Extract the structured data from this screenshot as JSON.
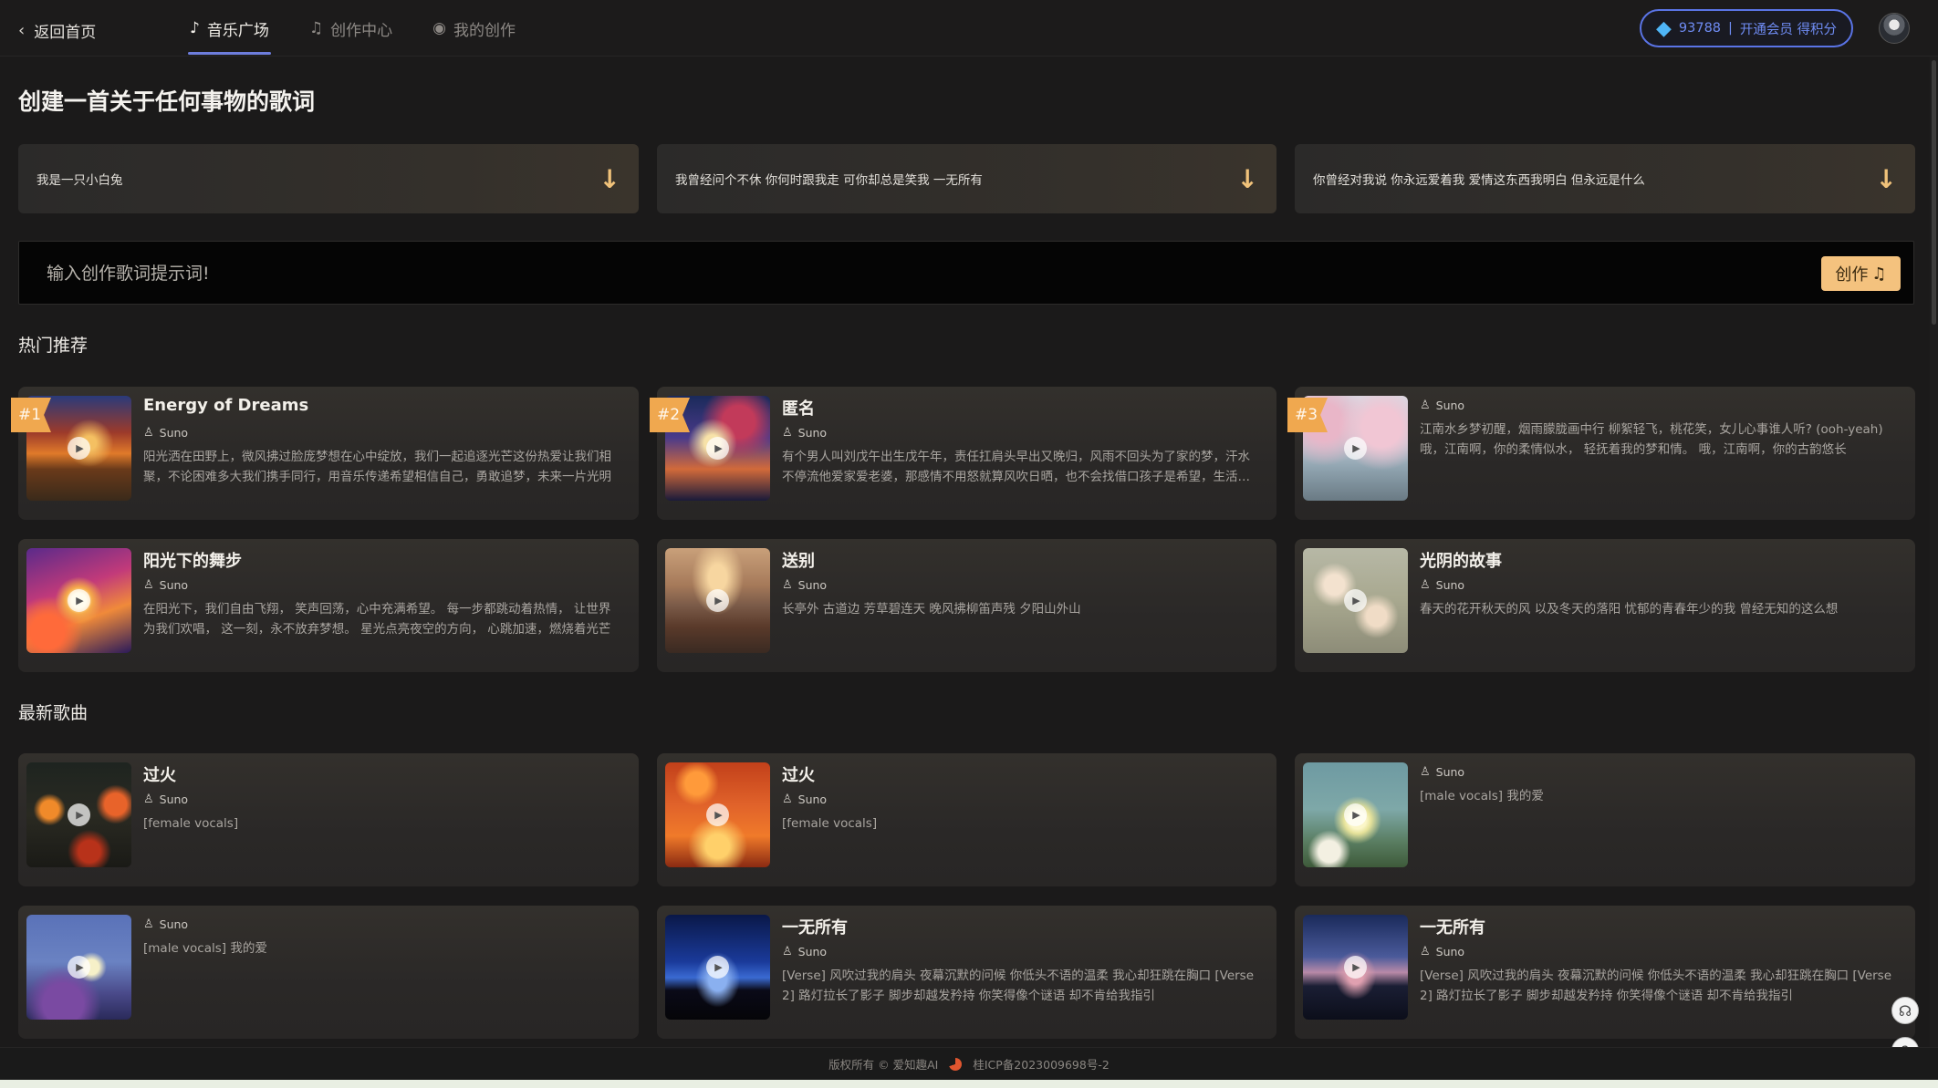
{
  "header": {
    "back_label": "返回首页",
    "tabs": [
      {
        "label": "音乐广场",
        "icon": "music-plaza-icon",
        "active": true
      },
      {
        "label": "创作中心",
        "icon": "music-note-icon",
        "active": false
      },
      {
        "label": "我的创作",
        "icon": "lightbulb-icon",
        "active": false
      }
    ],
    "member_points": "93788",
    "member_sep": "|",
    "member_label": "开通会员 得积分"
  },
  "page_title": "创建一首关于任何事物的歌词",
  "suggestions": [
    {
      "text": "我是一只小白兔",
      "icon": "arrow-down-icon"
    },
    {
      "text": "我曾经问个不休 你何时跟我走 可你却总是笑我 一无所有",
      "icon": "arrow-down-icon"
    },
    {
      "text": "你曾经对我说 你永远爱着我 爱情这东西我明白 但永远是什么",
      "icon": "arrow-down-icon"
    }
  ],
  "prompt": {
    "placeholder": "输入创作歌词提示词!",
    "button_label": "创作"
  },
  "sections": {
    "hot": "热门推荐",
    "latest": "最新歌曲"
  },
  "hot_songs": [
    {
      "rank": "#1",
      "title": "Energy of Dreams",
      "author": "Suno",
      "lyrics": "阳光洒在田野上，微风拂过脸庞梦想在心中绽放，我们一起追逐光芒这份热爱让我们相聚，不论困难多大我们携手同行，用音乐传递希望相信自己，勇敢追梦，未来一片光明",
      "cover": "sunset-tree"
    },
    {
      "rank": "#2",
      "title": "匿名",
      "author": "Suno",
      "lyrics": "有个男人叫刘戊午出生戊午年，责任扛肩头早出又晚归，风雨不回头为了家的梦，汗水不停流他爱家爱老婆，那感情不用怒就算风吹日晒，也不会找借口孩子是希望，生活的力量",
      "cover": "storm-clouds"
    },
    {
      "rank": "#3",
      "title": "",
      "author": "Suno",
      "lyrics": "江南水乡梦初醒，烟雨朦胧画中行 柳絮轻飞，桃花笑，女儿心事谁人听? (ooh-yeah) 哦，江南啊，你的柔情似水， 轻抚着我的梦和情。 哦，江南啊，你的古韵悠长",
      "cover": "blossom-lake"
    },
    {
      "rank": "",
      "title": "阳光下的舞步",
      "author": "Suno",
      "lyrics": "在阳光下，我们自由飞翔， 笑声回荡，心中充满希望。 每一步都跳动着热情， 让世界为我们欢唱， 这一刻，永不放弃梦想。 星光点亮夜空的方向， 心跳加速，燃烧着光芒",
      "cover": "colorful-sun"
    },
    {
      "rank": "",
      "title": "送别",
      "author": "Suno",
      "lyrics": "长亭外 古道边 芳草碧连天 晚风拂柳笛声残 夕阳山外山",
      "cover": "river-dusk"
    },
    {
      "rank": "",
      "title": "光阴的故事",
      "author": "Suno",
      "lyrics": "春天的花开秋天的风 以及冬天的落阳 忧郁的青春年少的我 曾经无知的这么想",
      "cover": "pale-flowers"
    }
  ],
  "latest_songs": [
    {
      "title": "过火",
      "author": "Suno",
      "lyrics": "[female vocals]",
      "cover": "lanterns-dark"
    },
    {
      "title": "过火",
      "author": "Suno",
      "lyrics": "[female vocals]",
      "cover": "lanterns-orange"
    },
    {
      "title": "",
      "author": "Suno",
      "lyrics": "[male vocals] 我的爱",
      "cover": "moon-daisies"
    },
    {
      "title": "",
      "author": "Suno",
      "lyrics": "[male vocals] 我的爱",
      "cover": "purple-flowers"
    },
    {
      "title": "一无所有",
      "author": "Suno",
      "lyrics": "[Verse] 风吹过我的肩头 夜幕沉默的问候 你低头不语的温柔 我心却狂跳在胸口 [Verse 2] 路灯拉长了影子 脚步却越发矜持 你笑得像个谜语 却不肯给我指引",
      "cover": "night-mountain"
    },
    {
      "title": "一无所有",
      "author": "Suno",
      "lyrics": "[Verse] 风吹过我的肩头 夜幕沉默的问候 你低头不语的温柔 我心却狂跳在胸口 [Verse 2] 路灯拉长了影子 脚步却越发矜持 你笑得像个谜语 却不肯给我指引",
      "cover": "dusk-mountain"
    }
  ],
  "footer": {
    "copyright": "版权所有 © 爱知趣AI",
    "icp": "桂ICP备2023009698号-2"
  },
  "colors": {
    "accent": "#f4c27e",
    "rank_badge": "#f0a84f",
    "member_border": "#5a74e6",
    "tab_underline": "#6d7ddc"
  }
}
